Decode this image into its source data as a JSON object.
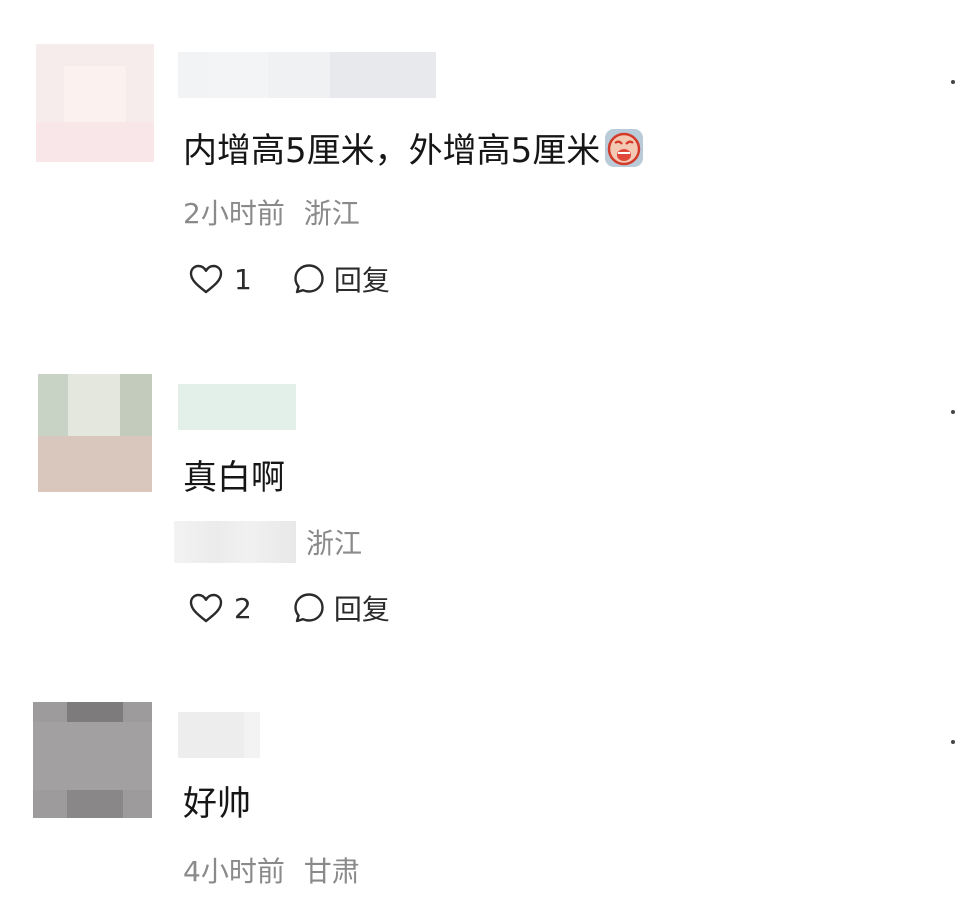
{
  "comments": [
    {
      "text": "内增高5厘米，外增高5厘米",
      "emoji": "crying-face-emoji",
      "time": "2小时前",
      "location": "浙江",
      "likes": "1",
      "reply_label": "回复"
    },
    {
      "text": "真白啊",
      "time": "",
      "location": "浙江",
      "likes": "2",
      "reply_label": "回复"
    },
    {
      "text": "好帅",
      "time": "4小时前",
      "location": "甘肃"
    }
  ],
  "icons": {
    "like": "heart-outline-icon",
    "reply": "speech-bubble-icon",
    "more": "more-dots-icon"
  },
  "colors": {
    "text": "#161616",
    "meta": "#8a8a8a",
    "icon": "#2b2b2b"
  }
}
